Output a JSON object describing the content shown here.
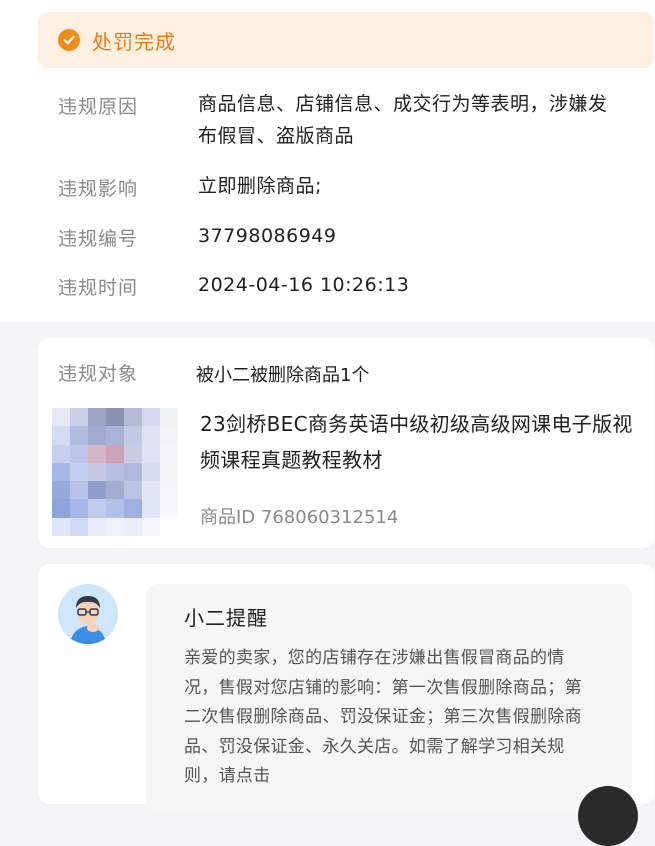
{
  "status": {
    "text": "处罚完成",
    "color": "#ec7c11",
    "icon": "check-circle-icon"
  },
  "violation": {
    "reason_label": "违规原因",
    "reason_value": "商品信息、店铺信息、成交行为等表明，涉嫌发布假冒、盗版商品",
    "impact_label": "违规影响",
    "impact_value": "立即删除商品;",
    "number_label": "违规编号",
    "number_value": "37798086949",
    "time_label": "违规时间",
    "time_value": "2024-04-16 10:26:13"
  },
  "target": {
    "label": "违规对象",
    "summary": "被小二被删除商品1个",
    "product_title": "23剑桥BEC商务英语中级初级高级网课电子版视频课程真题教程教材",
    "product_id": "商品ID 768060312514",
    "thumbnail": "blurred-product-image"
  },
  "tip": {
    "title": "小二提醒",
    "body": "亲爱的卖家，您的店铺存在涉嫌出售假冒商品的情况，售假对您店铺的影响：第一次售假删除商品；第二次售假删除商品、罚没保证金；第三次售假删除商品、罚没保证金、永久关店。如需了解学习相关规则，请点击",
    "avatar": "assistant-avatar-icon"
  }
}
